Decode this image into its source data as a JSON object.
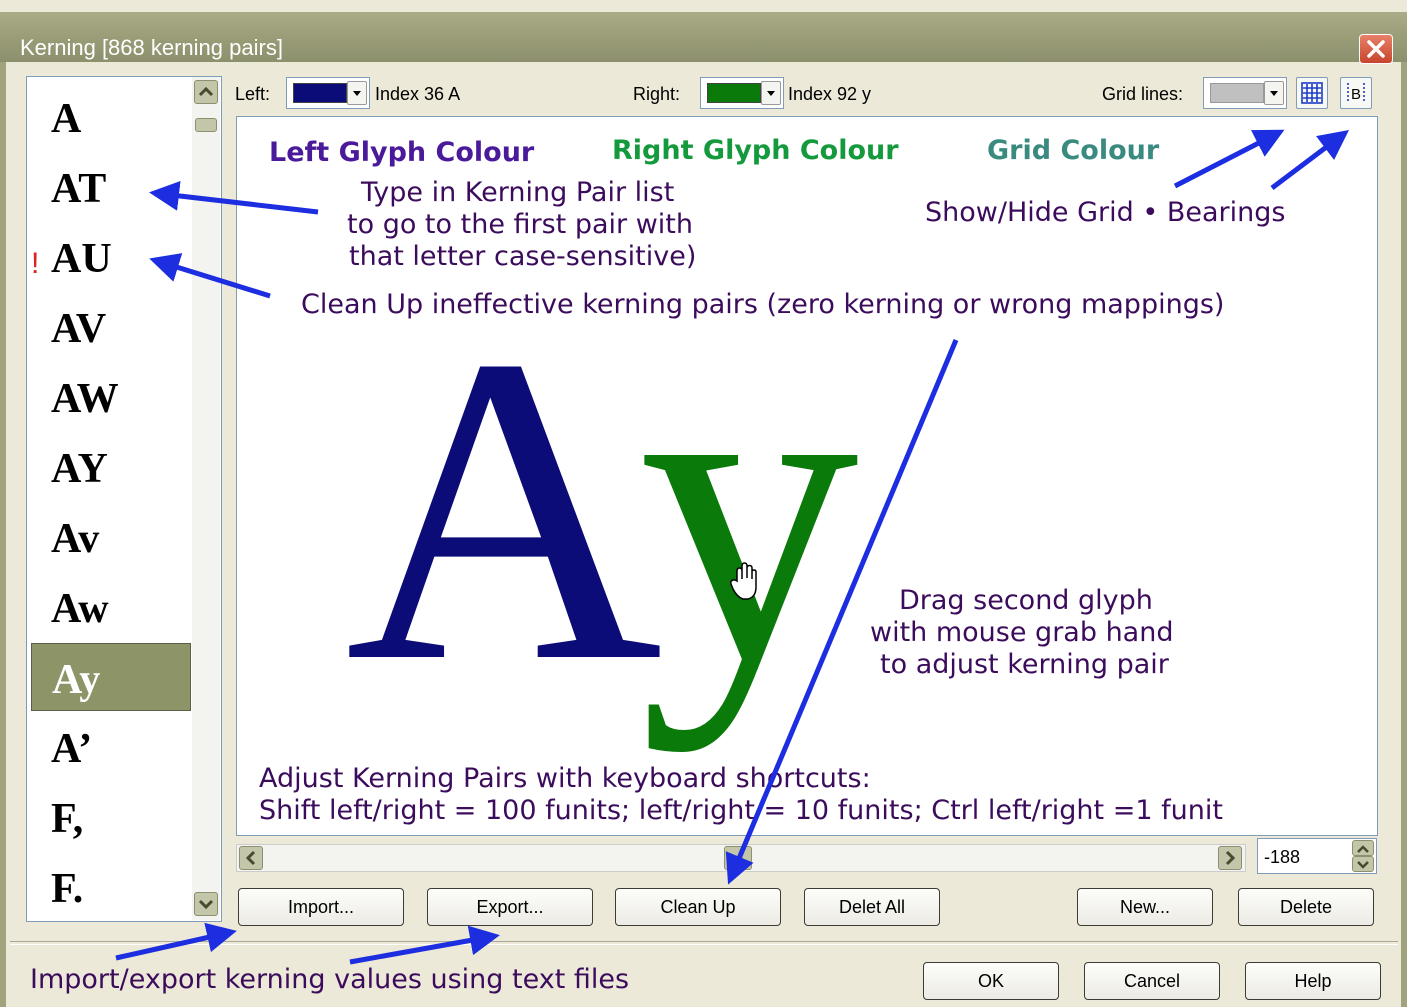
{
  "window": {
    "title": "Kerning [868 kerning pairs]"
  },
  "pair_list": {
    "items": [
      {
        "label": "A",
        "warning": "",
        "selected": false
      },
      {
        "label": "AT",
        "warning": "",
        "selected": false
      },
      {
        "label": "AU",
        "warning": "!",
        "selected": false
      },
      {
        "label": "AV",
        "warning": "",
        "selected": false
      },
      {
        "label": "AW",
        "warning": "",
        "selected": false
      },
      {
        "label": "AY",
        "warning": "",
        "selected": false
      },
      {
        "label": "Av",
        "warning": "",
        "selected": false
      },
      {
        "label": "Aw",
        "warning": "",
        "selected": false
      },
      {
        "label": "Ay",
        "warning": "",
        "selected": true
      },
      {
        "label": "A’",
        "warning": "",
        "selected": false
      },
      {
        "label": "F,",
        "warning": "",
        "selected": false
      },
      {
        "label": "F.",
        "warning": "",
        "selected": false
      }
    ]
  },
  "controls": {
    "left_label": "Left:",
    "left_index": "Index 36 A",
    "right_label": "Right:",
    "right_index": "Index 92 y",
    "grid_label": "Grid lines:",
    "bearings_glyph": "B"
  },
  "colors": {
    "left_glyph": "#0c0c78",
    "right_glyph": "#0a7a0a",
    "grid": "#c0c0c0",
    "annotation": "#3c0c5c",
    "arrow": "#1c2ee0",
    "selected_item": "#8c9468"
  },
  "canvas": {
    "left_glyph": "A",
    "right_glyph": "y",
    "legend": {
      "left": "Left Glyph Colour",
      "right": "Right Glyph Colour",
      "grid": "Grid Colour"
    },
    "notes": {
      "type_line1": "Type in Kerning Pair list",
      "type_line2": "to go to the first pair with",
      "type_line3": "that letter case-sensitive)",
      "show_hide": "Show/Hide Grid • Bearings",
      "clean_up": "Clean Up ineffective kerning pairs (zero kerning or wrong mappings)",
      "drag_line1": "Drag second glyph",
      "drag_line2": "with mouse grab hand",
      "drag_line3": "to adjust kerning pair",
      "keys_line1": "Adjust Kerning Pairs with keyboard shortcuts:",
      "keys_line2": "Shift left/right = 100 funits; left/right = 10 funits; Ctrl left/right =1 funit"
    }
  },
  "kerning_value": "-188",
  "buttons": {
    "import": "Import...",
    "export": "Export...",
    "clean_up": "Clean Up",
    "delete_all": "Delet All",
    "new": "New...",
    "delete": "Delete",
    "ok": "OK",
    "cancel": "Cancel",
    "help": "Help"
  },
  "bottom_note": "Import/export kerning values using text files"
}
